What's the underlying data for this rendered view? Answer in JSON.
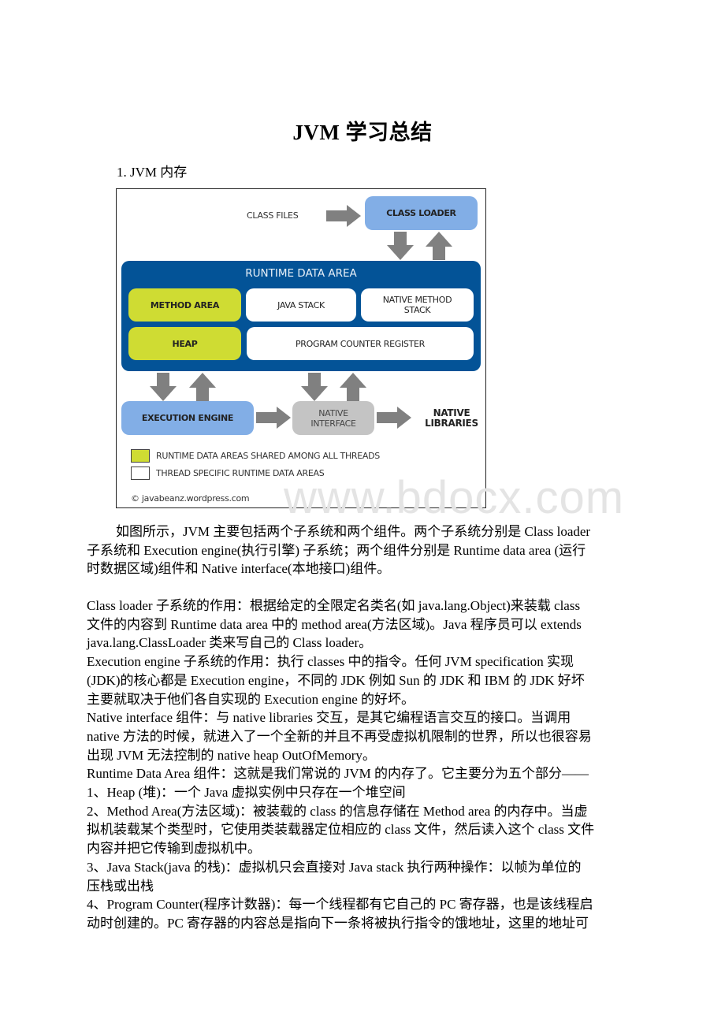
{
  "document": {
    "title": "JVM 学习总结",
    "section_heading": "1. JVM 内存",
    "watermark": "www.bdocx.com"
  },
  "diagram": {
    "class_files": "CLASS FILES",
    "class_loader": "CLASS LOADER",
    "runtime_data_area": "RUNTIME DATA AREA",
    "method_area": "METHOD AREA",
    "java_stack": "JAVA STACK",
    "native_method_stack_1": "NATIVE METHOD",
    "native_method_stack_2": "STACK",
    "heap": "HEAP",
    "program_counter_register": "PROGRAM COUNTER REGISTER",
    "execution_engine": "EXECUTION ENGINE",
    "native_interface_1": "NATIVE",
    "native_interface_2": "INTERFACE",
    "native_libraries_1": "NATIVE",
    "native_libraries_2": "LIBRARIES",
    "legend": [
      {
        "label": "RUNTIME DATA AREAS SHARED AMONG ALL THREADS",
        "color": "#cfdc33"
      },
      {
        "label": "THREAD SPECIFIC RUNTIME DATA AREAS",
        "color": "#ffffff"
      }
    ],
    "credit": "© javabeanz.wordpress.com",
    "colors": {
      "runtime_area": "#035397",
      "loader_engine": "#82aee6",
      "shared": "#cfdc33",
      "native_interface": "#c4c4c4",
      "arrow": "#808080"
    }
  },
  "body": {
    "intro": [
      "如图所示，JVM 主要包括两个子系统和两个组件。两个子系统分别是 Class loader",
      "子系统和 Execution engine(执行引擎) 子系统；两个组件分别是 Runtime data area (运行",
      "时数据区域)组件和 Native interface(本地接口)组件。"
    ],
    "lines": [
      "Class loader 子系统的作用：根据给定的全限定名类名(如 java.lang.Object)来装载 class",
      "文件的内容到 Runtime data area 中的 method area(方法区域)。Java 程序员可以 extends",
      "java.lang.ClassLoader 类来写自己的 Class loader。",
      "Execution engine 子系统的作用：执行 classes 中的指令。任何 JVM specification 实现",
      "(JDK)的核心都是 Execution engine，不同的 JDK 例如 Sun 的 JDK 和 IBM 的 JDK 好坏",
      "主要就取决于他们各自实现的 Execution engine 的好坏。",
      "Native interface 组件：与 native libraries 交互，是其它编程语言交互的接口。当调用",
      "native 方法的时候，就进入了一个全新的并且不再受虚拟机限制的世界，所以也很容易",
      "出现 JVM 无法控制的 native heap OutOfMemory。",
      "Runtime Data Area 组件：这就是我们常说的 JVM 的内存了。它主要分为五个部分——",
      "1、Heap (堆)：一个 Java 虚拟实例中只存在一个堆空间",
      "2、Method Area(方法区域)：被装载的 class 的信息存储在 Method area 的内存中。当虚",
      "拟机装载某个类型时，它使用类装载器定位相应的 class 文件，然后读入这个 class 文件",
      "内容并把它传输到虚拟机中。",
      "3、Java Stack(java 的栈)：虚拟机只会直接对 Java stack 执行两种操作：以帧为单位的",
      "压栈或出栈",
      "4、Program Counter(程序计数器)：每一个线程都有它自己的 PC 寄存器，也是该线程启",
      "动时创建的。PC 寄存器的内容总是指向下一条将被执行指令的饿地址，这里的地址可"
    ]
  }
}
